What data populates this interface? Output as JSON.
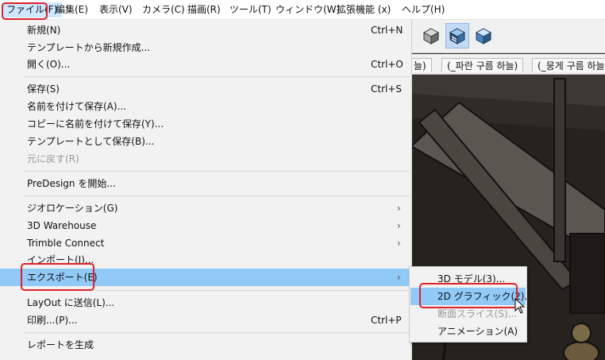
{
  "menubar": {
    "items": [
      {
        "label": "ファイル(F)"
      },
      {
        "label": "編集(E)"
      },
      {
        "label": "表示(V)"
      },
      {
        "label": "カメラ(C)"
      },
      {
        "label": "描画(R)"
      },
      {
        "label": "ツール(T)"
      },
      {
        "label": "ウィンドウ(W)"
      },
      {
        "label": "拡張機能 (x)"
      },
      {
        "label": "ヘルプ(H)"
      }
    ]
  },
  "toolbar": {
    "icons": [
      "box-iso-icon",
      "box-layered-icon",
      "box-cube-icon"
    ]
  },
  "scene_tabs": [
    "늘)",
    "(_파란 구름 하늘)",
    "(_뭉게 구름 하늘"
  ],
  "file_menu": {
    "items": [
      {
        "label": "新規(N)",
        "shortcut": "Ctrl+N"
      },
      {
        "label": "テンプレートから新規作成..."
      },
      {
        "label": "開く(O)...",
        "shortcut": "Ctrl+O"
      },
      {
        "label": "保存(S)",
        "shortcut": "Ctrl+S"
      },
      {
        "label": "名前を付けて保存(A)..."
      },
      {
        "label": "コピーに名前を付けて保存(Y)..."
      },
      {
        "label": "テンプレートとして保存(B)..."
      },
      {
        "label": "元に戻す(R)"
      },
      {
        "label": "PreDesign を開始..."
      },
      {
        "label": "ジオロケーション(G)"
      },
      {
        "label": "3D Warehouse"
      },
      {
        "label": "Trimble Connect"
      },
      {
        "label": "インポート(I)..."
      },
      {
        "label": "エクスポート(E)"
      },
      {
        "label": "LayOut に送信(L)..."
      },
      {
        "label": "印刷...(P)...",
        "shortcut": "Ctrl+P"
      },
      {
        "label": "レポートを生成"
      }
    ]
  },
  "export_submenu": {
    "items": [
      {
        "label": "3D モデル(3)..."
      },
      {
        "label": "2D グラフィック(2)..."
      },
      {
        "label": "断面スライス(S)..."
      },
      {
        "label": "アニメーション(A)"
      }
    ]
  },
  "colors": {
    "highlight": "#91c9f7",
    "annotation": "#e0202a",
    "menu_bg": "#f2f2f2"
  }
}
